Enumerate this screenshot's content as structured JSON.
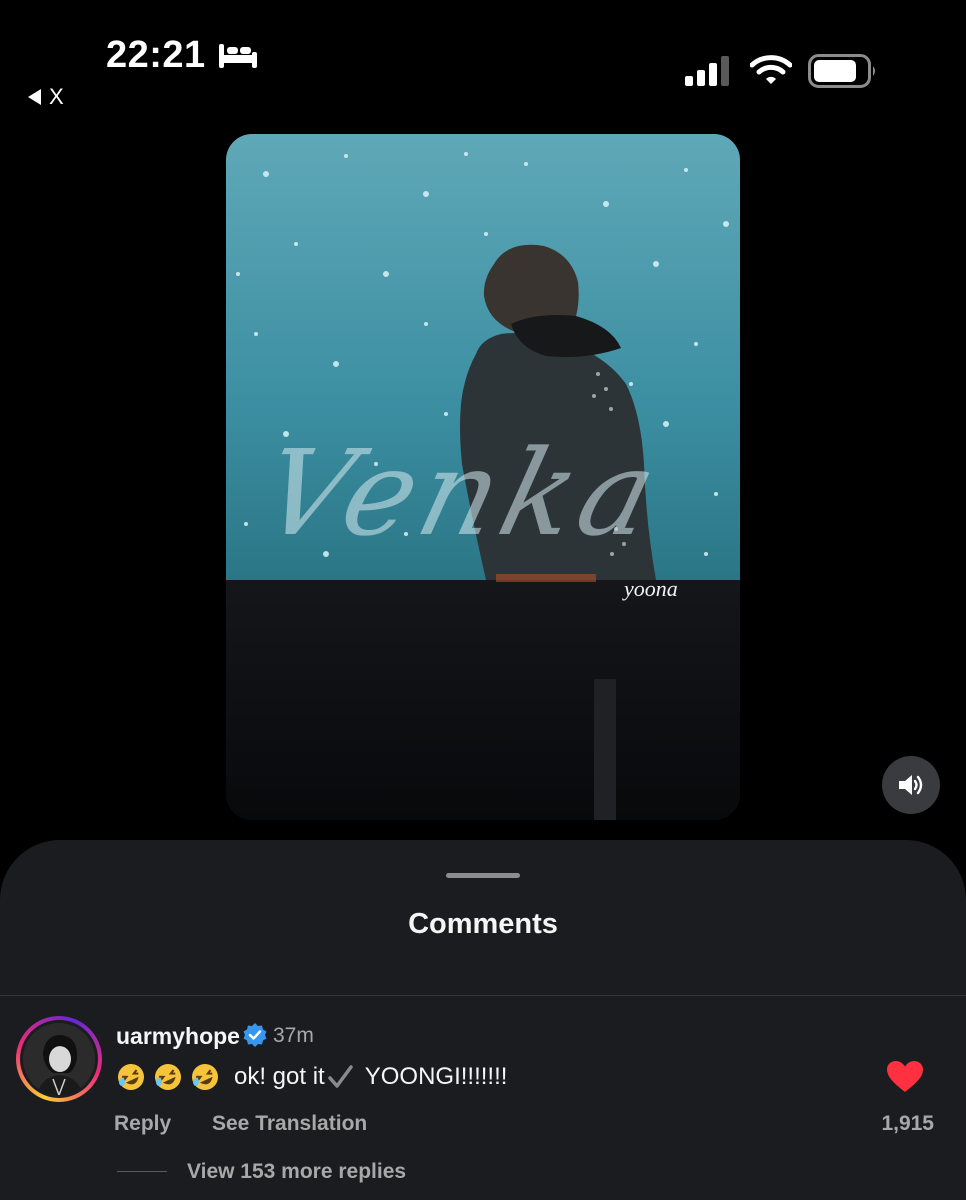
{
  "status_bar": {
    "time": "22:21",
    "back_label": "X",
    "icons": [
      "bed-icon",
      "signal-icon",
      "wifi-icon",
      "battery-icon"
    ]
  },
  "media": {
    "watermark_main": "Venka",
    "watermark_small": "yoona",
    "sound_icon": "speaker-icon"
  },
  "comments": {
    "title": "Comments",
    "items": [
      {
        "username": "uarmyhope",
        "verified": true,
        "time": "37m",
        "text": "ok! got it",
        "text_tail": "YOONGI!!!!!!!",
        "emoji": "rolling-on-floor-laughing x3",
        "reply_label": "Reply",
        "translate_label": "See Translation",
        "likes": "1,915",
        "liked": true,
        "view_replies": "View 153 more replies"
      }
    ]
  },
  "colors": {
    "background": "#000000",
    "sheet": "#1b1c1f",
    "verified": "#3797f0",
    "heart": "#ff3040",
    "secondary_text": "#a8a8a8"
  }
}
